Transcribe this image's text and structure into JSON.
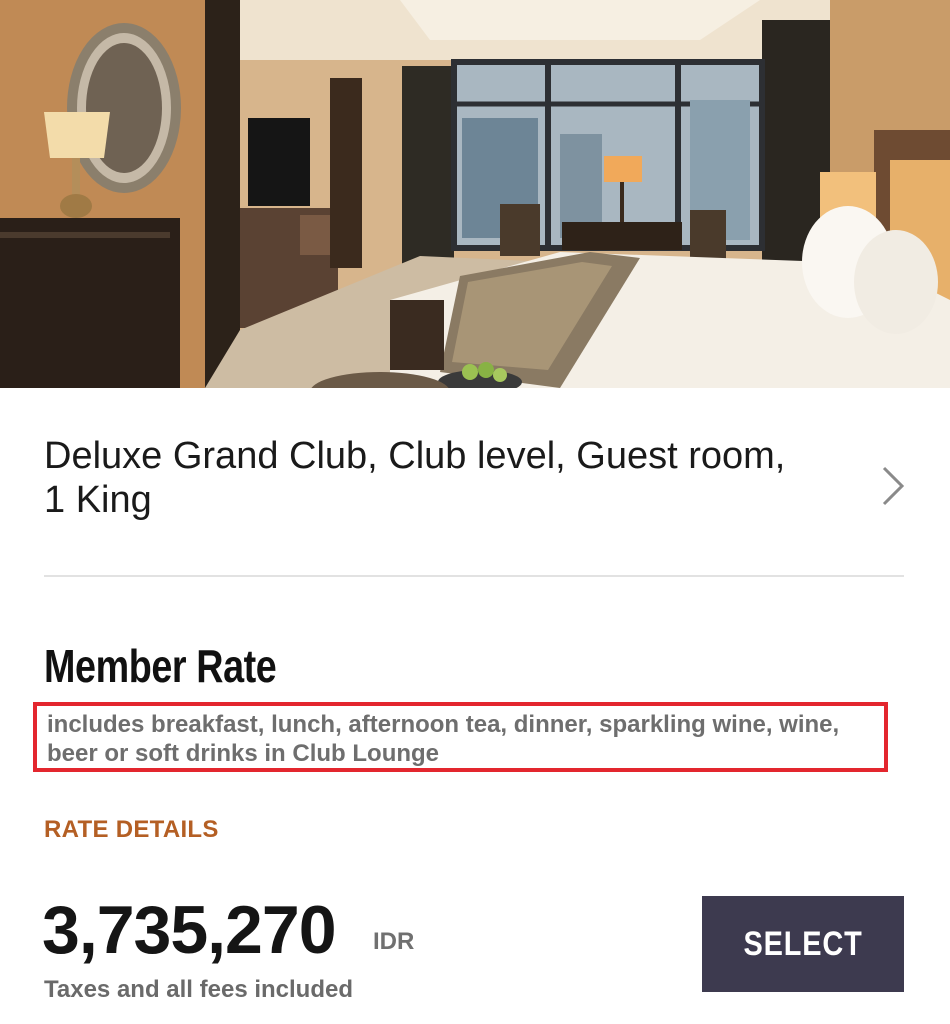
{
  "room": {
    "title": "Deluxe Grand Club, Club level, Guest room, 1 King",
    "chevron_icon": "chevron-right-icon",
    "photo_icon": "hotel-room-photo"
  },
  "rate": {
    "title": "Member Rate",
    "description": "includes breakfast, lunch, afternoon tea, dinner,  sparkling wine, wine, beer or soft drinks in Club Lounge",
    "details_link": "RATE DETAILS",
    "highlight_color": "#e3262e",
    "link_color": "#b45f24"
  },
  "price": {
    "amount": "3,735,270",
    "currency": "IDR",
    "note": "Taxes and all fees included"
  },
  "actions": {
    "select_label": "SELECT",
    "button_color": "#3d3a4f"
  }
}
